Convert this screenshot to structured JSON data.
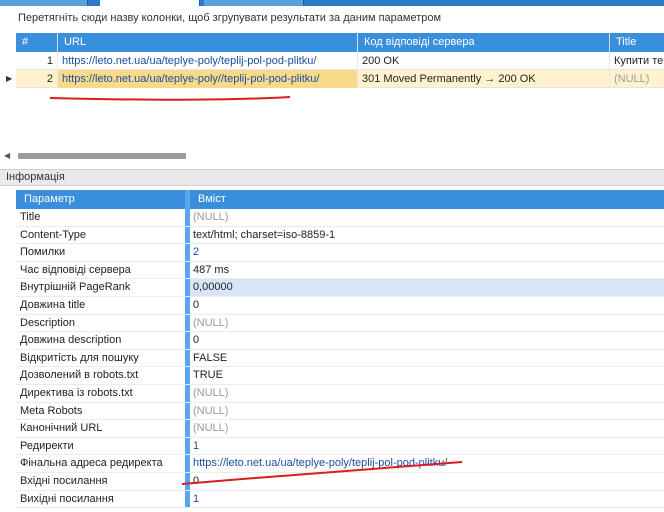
{
  "group_hint": "Перетягніть сюди назву колонки, щоб згрупувати результати за даним параметром",
  "upper_grid": {
    "columns": [
      "#",
      "URL",
      "Код відповіді сервера",
      "Title"
    ],
    "rows": [
      {
        "num": "1",
        "url": "https://leto.net.ua/ua/teplye-poly/teplij-pol-pod-plitku/",
        "code": "200 OK",
        "title": "Купити тепл"
      },
      {
        "num": "2",
        "url": "https://leto.net.ua/ua/teplye-poly//teplij-pol-pod-plitku/",
        "code": "301 Moved Permanently → 200 OK",
        "title": "(NULL)"
      }
    ],
    "selected_row": 2
  },
  "info_panel": {
    "title": "Інформація",
    "columns": [
      "Параметр",
      "Вміст"
    ],
    "rows": [
      {
        "key": "Title",
        "value": "(NULL)",
        "type": "null"
      },
      {
        "key": "Content-Type",
        "value": "text/html; charset=iso-8859-1",
        "type": "text"
      },
      {
        "key": "Помилки",
        "value": "2",
        "type": "blue"
      },
      {
        "key": "Час відповіді сервера",
        "value": "487 ms",
        "type": "text"
      },
      {
        "key": "Внутрішній PageRank",
        "value": "0,00000",
        "type": "text",
        "highlight": true
      },
      {
        "key": "Довжина title",
        "value": "0",
        "type": "text"
      },
      {
        "key": "Description",
        "value": "(NULL)",
        "type": "null"
      },
      {
        "key": "Довжина description",
        "value": "0",
        "type": "text"
      },
      {
        "key": "Відкритість для пошуку",
        "value": "FALSE",
        "type": "text"
      },
      {
        "key": "Дозволений в robots.txt",
        "value": "TRUE",
        "type": "text"
      },
      {
        "key": "Директива із robots.txt",
        "value": "(NULL)",
        "type": "null"
      },
      {
        "key": "Meta Robots",
        "value": "(NULL)",
        "type": "null"
      },
      {
        "key": "Канонічний URL",
        "value": "(NULL)",
        "type": "null"
      },
      {
        "key": "Редиректи",
        "value": "1",
        "type": "blue"
      },
      {
        "key": "Фінальна адреса редиректа",
        "value": "https://leto.net.ua/ua/teplye-poly/teplij-pol-pod-plitku/",
        "type": "blue"
      },
      {
        "key": "Вхідні посилання",
        "value": "0",
        "type": "text"
      },
      {
        "key": "Вихідні посилання",
        "value": "1",
        "type": "blue"
      }
    ]
  },
  "colors": {
    "header_blue": "#3a8fdc",
    "selected_row": "#fff2cc",
    "annotation_red": "#d81e1e"
  }
}
